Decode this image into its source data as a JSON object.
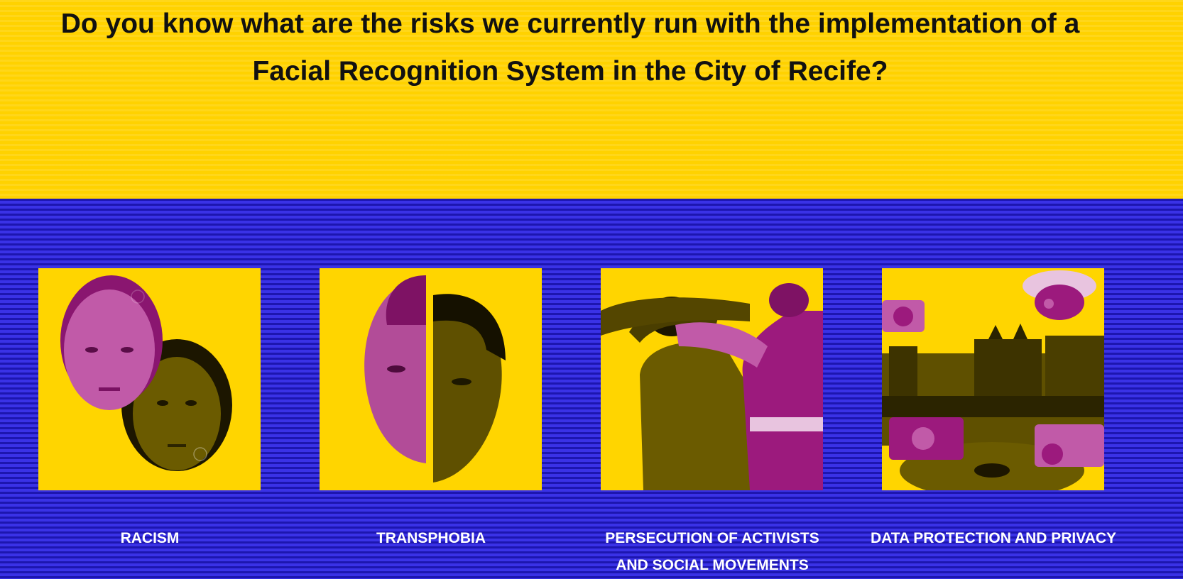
{
  "headline": {
    "line1": "Do you know what are the risks we currently run with the implementation of a",
    "line2": "Facial Recognition System in the City of Recife?"
  },
  "colors": {
    "top_background": "#ffd200",
    "bottom_background": "#2d25d4",
    "card_background": "#ffd500",
    "magenta": "#9c1a7d",
    "olive": "#5a4b00"
  },
  "cards": [
    {
      "label": "RACISM",
      "icon": "two-faces-image"
    },
    {
      "label": "TRANSPHOBIA",
      "icon": "split-face-image"
    },
    {
      "label_line1": "PERSECUTION OF ACTIVISTS",
      "label_line2": "AND SOCIAL MOVEMENTS",
      "icon": "arrest-image"
    },
    {
      "label": "DATA PROTECTION AND PRIVACY",
      "icon": "surveillance-cameras-city-image"
    }
  ]
}
